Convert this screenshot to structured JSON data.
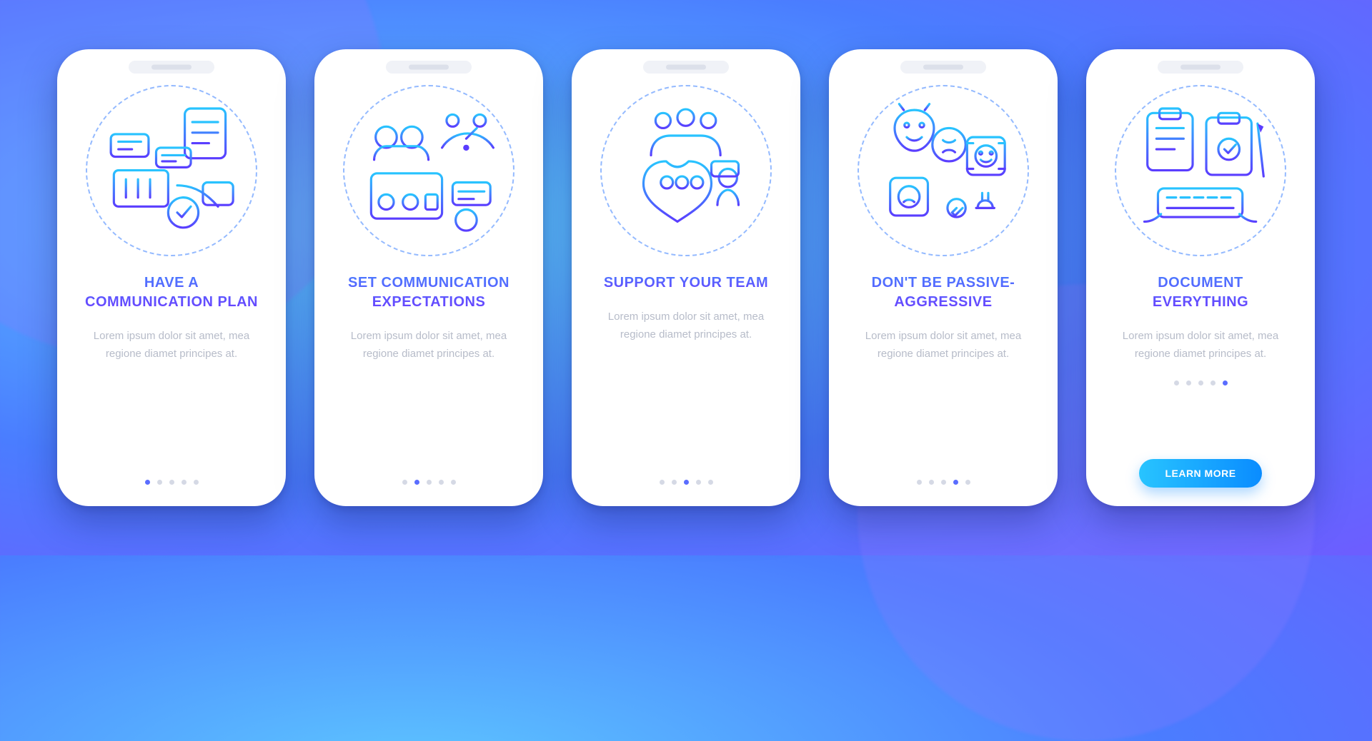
{
  "lipsum": "Lorem ipsum dolor sit amet, mea regione diamet principes at.",
  "screens": [
    {
      "id": "communication-plan",
      "icon": "communication-plan-icon",
      "heading": "HAVE A COMMUNICATION PLAN",
      "body": "Lorem ipsum dolor sit amet, mea regione diamet principes at.",
      "activeDot": 0
    },
    {
      "id": "set-expectations",
      "icon": "expectations-icon",
      "heading": "SET COMMUNICATION EXPECTATIONS",
      "body": "Lorem ipsum dolor sit amet, mea regione diamet principes at.",
      "activeDot": 1
    },
    {
      "id": "support-team",
      "icon": "support-team-icon",
      "heading": "SUPPORT YOUR TEAM",
      "body": "Lorem ipsum dolor sit amet, mea regione diamet principes at.",
      "activeDot": 2
    },
    {
      "id": "passive-aggressive",
      "icon": "passive-aggressive-icon",
      "heading": "DON'T BE PASSIVE-AGGRESSIVE",
      "body": "Lorem ipsum dolor sit amet, mea regione diamet principes at.",
      "activeDot": 3
    },
    {
      "id": "document-everything",
      "icon": "document-everything-icon",
      "heading": "DOCUMENT EVERYTHING",
      "body": "Lorem ipsum dolor sit amet, mea regione diamet principes at.",
      "activeDot": 4,
      "cta": "LEARN MORE"
    }
  ],
  "dotCount": 5
}
